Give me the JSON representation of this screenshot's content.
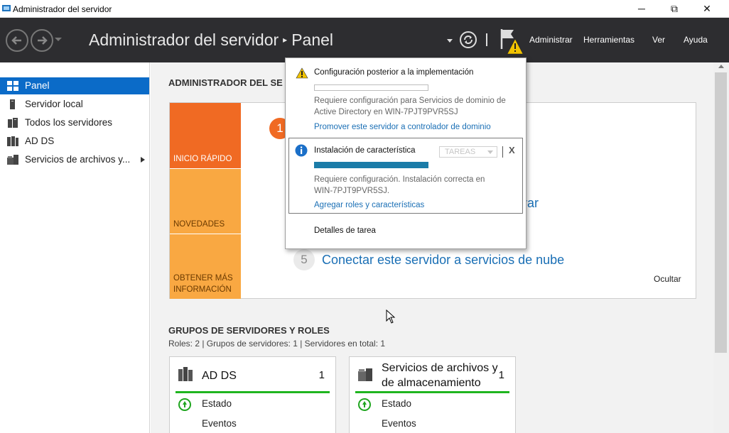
{
  "window": {
    "title": "Administrador del servidor",
    "minimize": "─",
    "restore": "⧉",
    "close": "✕"
  },
  "header": {
    "breadcrumb_root": "Administrador del servidor",
    "breadcrumb_sep": "▸",
    "breadcrumb_current": "Panel",
    "menu": {
      "manage": "Administrar",
      "tools": "Herramientas",
      "view": "Ver",
      "help": "Ayuda"
    }
  },
  "sidebar": {
    "items": [
      {
        "label": "Panel",
        "icon": "dashboard-icon"
      },
      {
        "label": "Servidor local",
        "icon": "server-icon"
      },
      {
        "label": "Todos los servidores",
        "icon": "servers-icon"
      },
      {
        "label": "AD DS",
        "icon": "adds-icon"
      },
      {
        "label": "Servicios de archivos y...",
        "icon": "file-services-icon"
      }
    ]
  },
  "main": {
    "welcome_title": "ADMINISTRADOR DEL SE",
    "tiles": {
      "quick_start": "INICIO RÁPIDO",
      "whats_new": "NOVEDADES",
      "learn_more_1": "OBTENER MÁS",
      "learn_more_2": "INFORMACIÓN"
    },
    "step1_number": "1",
    "step_partial": "istrar",
    "step5_number": "5",
    "step5_text": "Conectar este servidor a servicios de nube",
    "hide": "Ocultar",
    "groups_title": "GRUPOS DE SERVIDORES Y ROLES",
    "groups_sub": "Roles: 2   |   Grupos de servidores: 1   |   Servidores en total: 1",
    "cards": [
      {
        "title_1": "AD DS",
        "title_2": "",
        "count": "1",
        "status": "Estado",
        "events": "Eventos"
      },
      {
        "title_1": "Servicios de archivos y",
        "title_2": "de almacenamiento",
        "count": "1",
        "status": "Estado",
        "events": "Eventos"
      }
    ]
  },
  "notifications": {
    "item1": {
      "title": "Configuración posterior a la implementación",
      "text_1": "Requiere configuración para Servicios de dominio de",
      "text_2": "Active Directory en WIN-7PJT9PVR5SJ",
      "link": "Promover este servidor a controlador de dominio",
      "progress": 0
    },
    "item2": {
      "title": "Instalación de característica",
      "tasks": "TAREAS",
      "close": "X",
      "text_1": "Requiere configuración. Instalación correcta en",
      "text_2": "WIN-7PJT9PVR5SJ.",
      "link": "Agregar roles y características",
      "progress": 1.0
    },
    "task_details": "Detalles de tarea"
  },
  "colors": {
    "header_bg": "#2d2d30",
    "accent_blue": "#0b6bc8",
    "tile_orange": "#f06a23",
    "tile_light_orange": "#f9a842",
    "status_green": "#1fb51f",
    "link_blue": "#1a6fb5"
  }
}
